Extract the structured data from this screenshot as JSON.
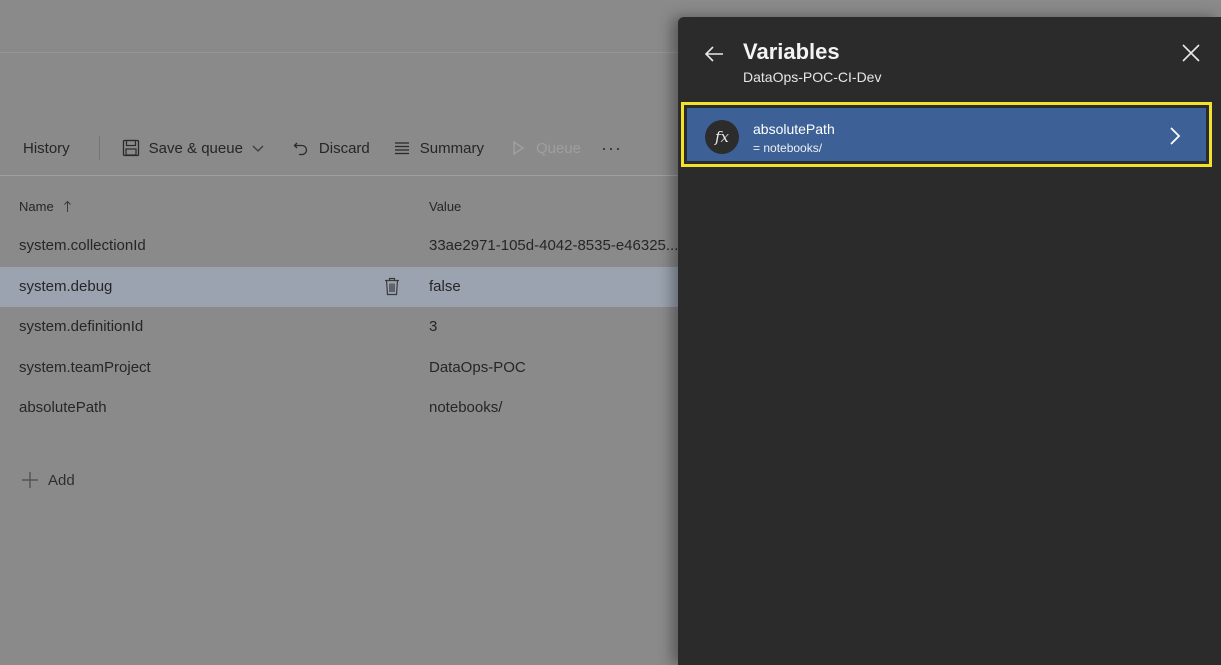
{
  "toolbar": {
    "history_label": "History",
    "save_queue_label": "Save & queue",
    "discard_label": "Discard",
    "summary_label": "Summary",
    "queue_label": "Queue",
    "more_label": "···"
  },
  "table": {
    "columns": {
      "name": "Name",
      "value": "Value"
    },
    "rows": [
      {
        "name": "system.collectionId",
        "value": "33ae2971-105d-4042-8535-e46325..."
      },
      {
        "name": "system.debug",
        "value": "false"
      },
      {
        "name": "system.definitionId",
        "value": "3"
      },
      {
        "name": "system.teamProject",
        "value": "DataOps-POC"
      },
      {
        "name": "absolutePath",
        "value": "notebooks/"
      }
    ],
    "add_label": "Add"
  },
  "panel": {
    "title": "Variables",
    "subtitle": "DataOps-POC-CI-Dev",
    "variable": {
      "icon_text": "fx",
      "name": "absolutePath",
      "value": "= notebooks/"
    }
  },
  "colors": {
    "panel_bg": "#2b2b2b",
    "selected_card": "#3d6196",
    "highlight_border": "#f2e229"
  }
}
